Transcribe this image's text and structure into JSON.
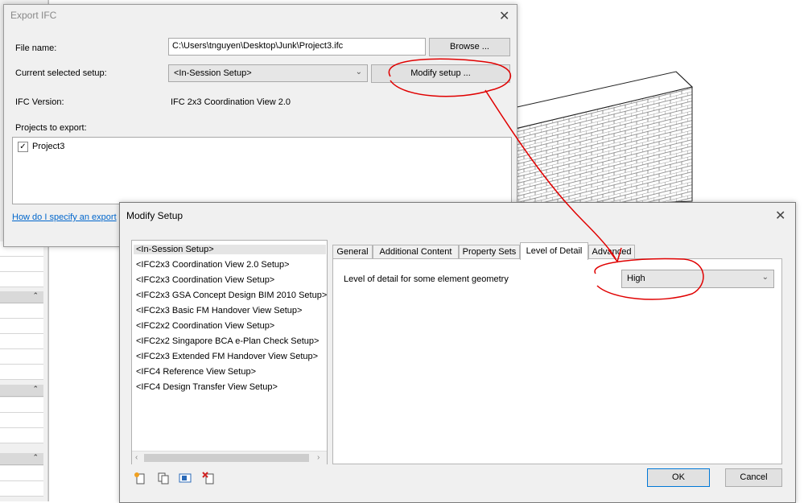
{
  "export_dialog": {
    "title": "Export IFC",
    "file_name_label": "File name:",
    "file_name_value": "C:\\Users\\tnguyen\\Desktop\\Junk\\Project3.ifc",
    "browse_label": "Browse ...",
    "setup_label": "Current selected setup:",
    "setup_value": "<In-Session Setup>",
    "modify_setup_label": "Modify setup ...",
    "ifc_version_label": "IFC Version:",
    "ifc_version_value": "IFC 2x3 Coordination View 2.0",
    "projects_label": "Projects to export:",
    "projects": [
      {
        "name": "Project3",
        "checked": true
      }
    ],
    "help_link": "How do I specify an export"
  },
  "modify_dialog": {
    "title": "Modify Setup",
    "setups": [
      "<In-Session Setup>",
      "<IFC2x3 Coordination View 2.0 Setup>",
      "<IFC2x3 Coordination View Setup>",
      "<IFC2x3 GSA Concept Design BIM 2010 Setup>",
      "<IFC2x3 Basic FM Handover View Setup>",
      "<IFC2x2 Coordination View Setup>",
      "<IFC2x2 Singapore BCA e-Plan Check Setup>",
      "<IFC2x3 Extended FM Handover View Setup>",
      "<IFC4 Reference View Setup>",
      "<IFC4 Design Transfer View Setup>"
    ],
    "selected_setup_index": 0,
    "tabs": [
      "General",
      "Additional Content",
      "Property Sets",
      "Level of Detail",
      "Advanced"
    ],
    "active_tab": "Level of Detail",
    "lod_label": "Level of detail for some element geometry",
    "lod_value": "High",
    "ok_label": "OK",
    "cancel_label": "Cancel"
  },
  "colors": {
    "annotation": "#e00000",
    "window_bg": "#f0f0f0",
    "link": "#0066cc"
  }
}
